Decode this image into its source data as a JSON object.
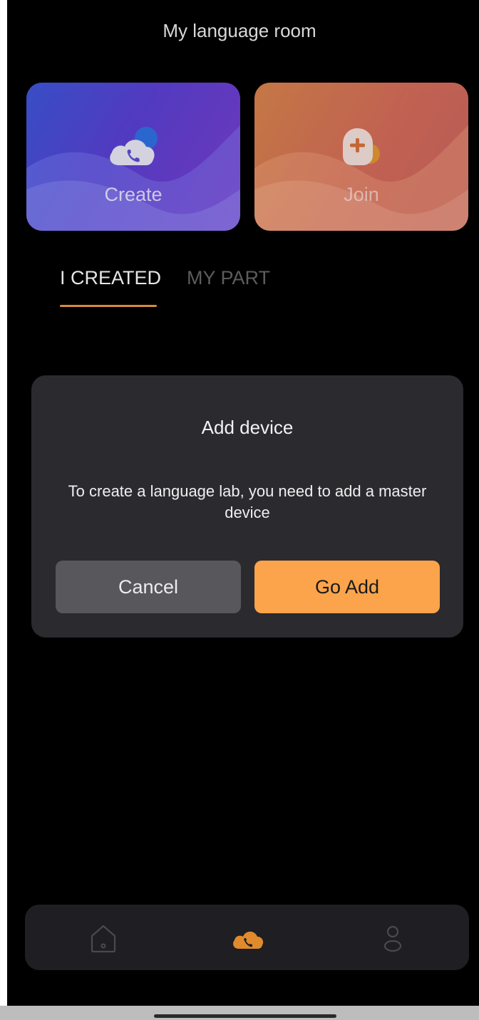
{
  "header": {
    "title": "My language room"
  },
  "cards": [
    {
      "label": "Create",
      "icon": "cloud-phone-icon"
    },
    {
      "label": "Join",
      "icon": "plus-badge-icon"
    }
  ],
  "tabs": [
    {
      "label": "I CREATED",
      "active": true
    },
    {
      "label": "MY PART",
      "active": false
    }
  ],
  "dialog": {
    "title": "Add device",
    "message": "To create a language lab, you need to add a master device",
    "cancel_label": "Cancel",
    "confirm_label": "Go Add"
  },
  "bottom_nav": {
    "items": [
      {
        "icon": "home-icon",
        "active": false
      },
      {
        "icon": "cloud-phone-icon",
        "active": true
      },
      {
        "icon": "person-icon",
        "active": false
      }
    ]
  },
  "colors": {
    "accent": "#fba44b",
    "tab_underline": "#d98a3a",
    "dialog_bg": "#2b2a2f",
    "background": "#000000"
  }
}
